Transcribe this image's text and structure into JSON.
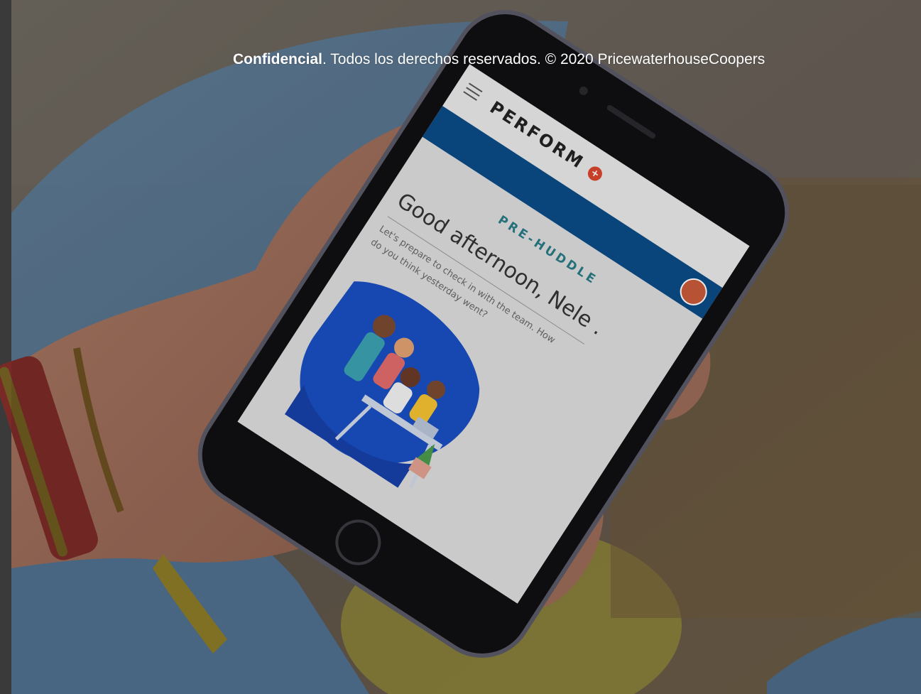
{
  "footer": {
    "confidential_label": "Confidencial",
    "rights_text": ". Todos los derechos reservados. © 2020 PricewaterhouseCoopers"
  },
  "phone_screen": {
    "app_logo": "PERFORM",
    "logo_badge": "+",
    "menu_icon": "hamburger-menu-icon",
    "section_title": "PRE-HUDDLE",
    "greeting": "Good afternoon, Nele .",
    "prompt_line1": "Let's prepare to check in with the team. How",
    "prompt_line2": "do you think yesterday went?"
  },
  "colors": {
    "header_blue": "#0a4a86",
    "screen_bg": "#dcdcdc",
    "section_title": "#2a7a86",
    "logo_badge": "#d8452c",
    "illustration_blue": "#1a4fc0"
  }
}
